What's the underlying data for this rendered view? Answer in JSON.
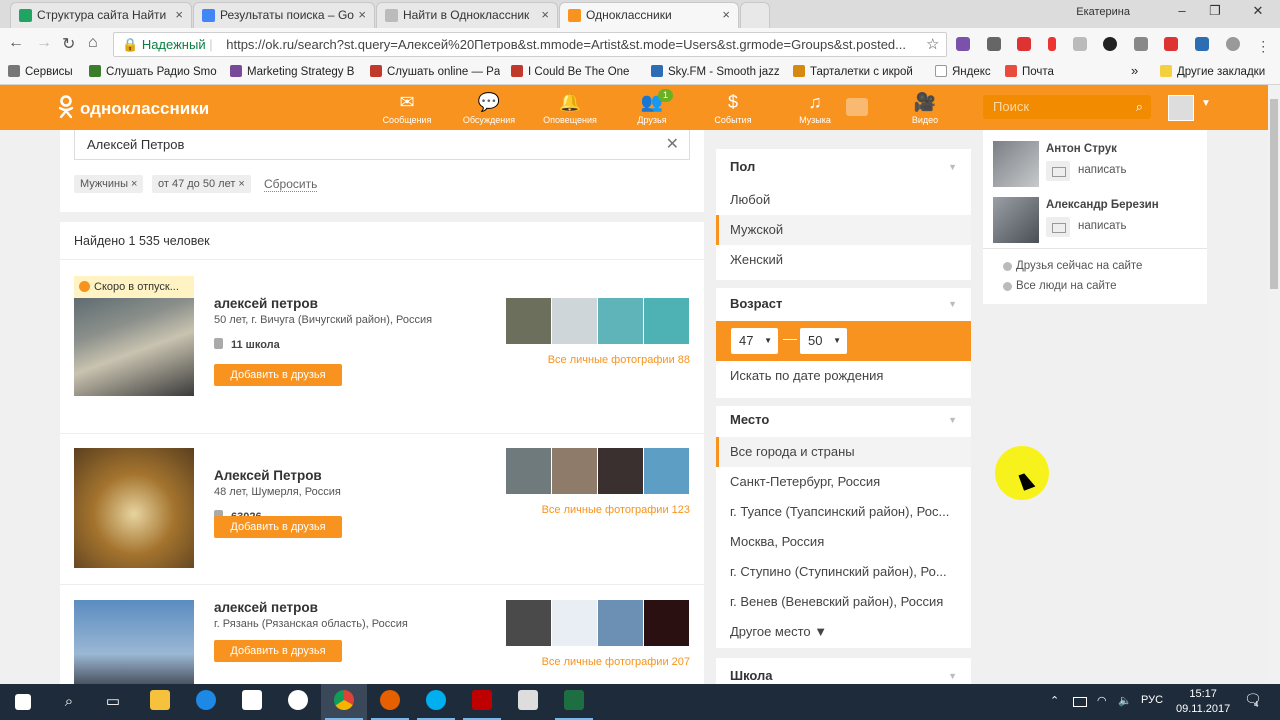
{
  "browser": {
    "tabs": [
      {
        "label": "Структура сайта Найти",
        "icon": "sheets-icon"
      },
      {
        "label": "Результаты поиска – Go",
        "icon": "drive-icon"
      },
      {
        "label": "Найти в Одноклассник",
        "icon": "page-icon"
      },
      {
        "label": "Одноклассники",
        "icon": "ok-icon"
      }
    ],
    "window_user": "Екатерина",
    "secure_label": "Надежный",
    "url": "https://ok.ru/search?st.query=Алексей%20Петров&st.mmode=Artist&st.mode=Users&st.grmode=Groups&st.posted...",
    "bookmarks": [
      {
        "label": "Сервисы",
        "color": "#777777"
      },
      {
        "label": "Слушать Радио Smo",
        "color": "#3a7d2c"
      },
      {
        "label": "Marketing Strategy B",
        "color": "#7a4a9a"
      },
      {
        "label": "Слушать online — Pa",
        "color": "#c0392b"
      },
      {
        "label": "I Could Be The One",
        "color": "#c0392b"
      },
      {
        "label": "Sky.FM - Smooth jazz",
        "color": "#2c6db3"
      },
      {
        "label": "Тарталетки с икрой",
        "color": "#d68910"
      },
      {
        "label": "Яндекс",
        "color": "#ffffff"
      },
      {
        "label": "Почта",
        "color": "#e74c3c"
      },
      {
        "label": "Другие закладки",
        "color": "#f4d03f"
      }
    ],
    "more_bookmarks": "»"
  },
  "ok": {
    "logo": "одноклассники",
    "nav": [
      {
        "label": "Сообщения",
        "icon": "mail-icon",
        "glyph": "✉"
      },
      {
        "label": "Обсуждения",
        "icon": "discussions-icon",
        "glyph": "💬"
      },
      {
        "label": "Оповещения",
        "icon": "bell-icon",
        "glyph": "🔔"
      },
      {
        "label": "Друзья",
        "icon": "friends-icon",
        "glyph": "👥",
        "badge": "1"
      },
      {
        "label": "События",
        "icon": "events-icon",
        "glyph": "$"
      },
      {
        "label": "Музыка",
        "icon": "music-icon",
        "glyph": "♫"
      },
      {
        "label": "Видео",
        "icon": "video-icon",
        "glyph": "🎥"
      }
    ],
    "search_placeholder": "Поиск"
  },
  "search": {
    "query": "Алексей Петров",
    "chips": [
      "Мужчины ×",
      "от 47 до 50 лет ×"
    ],
    "reset": "Сбросить",
    "found": "Найдено 1 535 человек",
    "results": [
      {
        "badge": "Скоро в отпуск...",
        "name": "алексей петров",
        "info": "50 лет, г. Вичуга (Вичугский район), Россия",
        "school": "11 школа",
        "add": "Добавить в друзья",
        "all_photos": "Все личные фотографии 88",
        "photo_colors": [
          "#6b6f5c",
          "#cfd6d9",
          "#5fb4b9",
          "#4eb1b4",
          "#3fa9b1"
        ]
      },
      {
        "name": "Алексей Петров",
        "info": "48 лет, Шумерля, Россия",
        "school": "63026",
        "add": "Добавить в друзья",
        "all_photos": "Все личные фотографии 123",
        "photo_colors": [
          "#8a6b3a",
          "#6f7a7d",
          "#8f7b6a",
          "#3a3030",
          "#5d9ec4"
        ]
      },
      {
        "name": "алексей петров",
        "info": "г. Рязань (Рязанская область), Россия",
        "add": "Добавить в друзья",
        "all_photos": "Все личные фотографии 207",
        "photo_colors": [
          "#3b6aa0",
          "#4a4a4a",
          "#e8eef4",
          "#6c8fb4",
          "#2a1010"
        ]
      }
    ]
  },
  "filters": {
    "gender": {
      "title": "Пол",
      "options": [
        "Любой",
        "Мужской",
        "Женский"
      ],
      "selected": "Мужской"
    },
    "age": {
      "title": "Возраст",
      "from": "47",
      "to": "50",
      "dash": "—",
      "by_birthdate": "Искать по дате рождения"
    },
    "place": {
      "title": "Место",
      "options": [
        "Все города и страны",
        "Санкт-Петербург, Россия",
        "г. Туапсе (Туапсинский район), Рос...",
        "Москва, Россия",
        "г. Ступино (Ступинский район), Ро...",
        "г. Венев (Веневский район), Россия"
      ],
      "selected": "Все города и страны",
      "other": "Другое место ▼"
    },
    "school": {
      "title": "Школа"
    }
  },
  "sidebar": {
    "friends": [
      {
        "name": "Антон Струк",
        "write": "написать"
      },
      {
        "name": "Александр Березин",
        "write": "написать"
      }
    ],
    "links": [
      "Друзья сейчас на сайте",
      "Все люди на сайте"
    ]
  },
  "taskbar": {
    "lang": "РУС",
    "time": "15:17",
    "date": "09.11.2017",
    "notifications": "4"
  }
}
